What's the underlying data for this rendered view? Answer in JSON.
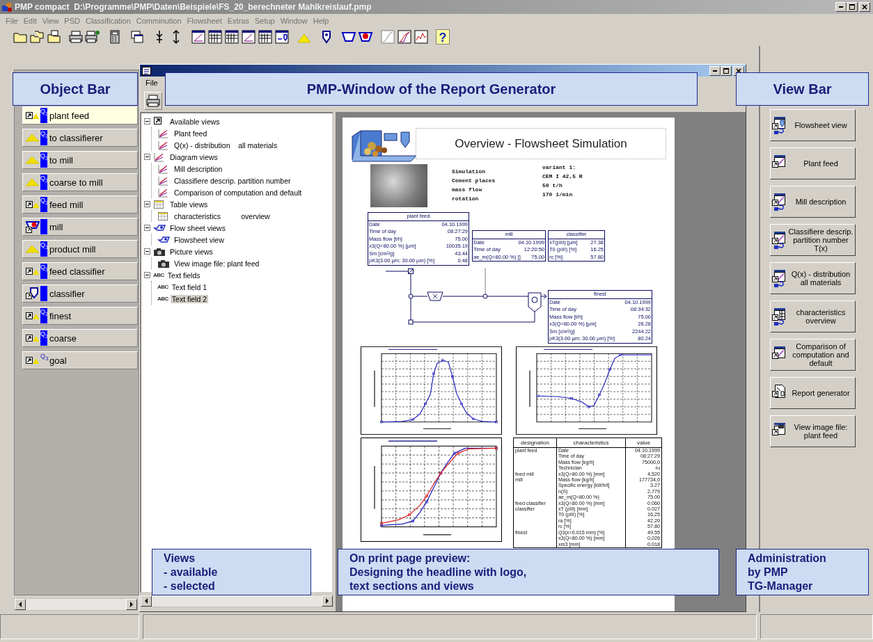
{
  "window": {
    "title": "PMP compact  D:\\Programme\\PMP\\Daten\\Beispiele\\FS_20_berechneter Mahlkreislauf.pmp"
  },
  "menu": [
    "File",
    "Edit",
    "View",
    "PSD",
    "Classification",
    "Comminution",
    "Flowsheet",
    "Extras",
    "Setup",
    "Window",
    "Help"
  ],
  "toolbar": {
    "help_glyph": "?"
  },
  "object_bar": {
    "items": [
      {
        "label": "plant feed",
        "kind": "shortcut",
        "badge": "Q$_{3}$",
        "selected": true
      },
      {
        "label": "to classifierer",
        "kind": "pile",
        "badge": "Q$_{3}$",
        "selected": false
      },
      {
        "label": "to mill",
        "kind": "pile",
        "badge": "Q$_{3}$",
        "selected": false
      },
      {
        "label": "coarse to mill",
        "kind": "pile",
        "badge": "Q$_{3}$",
        "selected": false
      },
      {
        "label": "feed mill",
        "kind": "shortcut",
        "badge": "Q$_{3}$",
        "selected": false
      },
      {
        "label": "mill",
        "kind": "mill",
        "selected": false
      },
      {
        "label": "product mill",
        "kind": "pile",
        "badge": "Q$_{3}$",
        "selected": false
      },
      {
        "label": "feed classifier",
        "kind": "shortcut",
        "badge": "Q$_{3}$",
        "selected": false
      },
      {
        "label": "classifier",
        "kind": "classifier",
        "selected": false
      },
      {
        "label": "finest",
        "kind": "shortcut",
        "badge": "Q$_{3}$",
        "selected": false
      },
      {
        "label": "coarse",
        "kind": "shortcut",
        "badge": "Q$_{3}$",
        "selected": false
      },
      {
        "label": "goal",
        "kind": "goal",
        "badge": "Q$_{3}$",
        "selected": false
      }
    ]
  },
  "report_window": {
    "menu": [
      "File"
    ],
    "tree": [
      {
        "label": "Available views",
        "kind": "shortcut",
        "expanded": true,
        "selected": false,
        "children": [
          {
            "label": "Plant feed",
            "kind": "chart",
            "selected": false
          },
          {
            "label": "Q(x) - distribution    all materials",
            "kind": "chart",
            "selected": false
          }
        ]
      },
      {
        "label": "Diagram views",
        "kind": "chart",
        "expanded": true,
        "selected": false,
        "children": [
          {
            "label": "Mill description",
            "kind": "chart",
            "selected": false
          },
          {
            "label": "Classifiere descrip. partition number",
            "kind": "chart",
            "selected": false
          },
          {
            "label": "Comparison of computation and default",
            "kind": "chart",
            "selected": false
          }
        ]
      },
      {
        "label": "Table views",
        "kind": "table",
        "expanded": true,
        "selected": false,
        "children": [
          {
            "label": "characteristics          overview",
            "kind": "table",
            "selected": false
          }
        ]
      },
      {
        "label": "Flow sheet views",
        "kind": "flowsheet",
        "expanded": true,
        "selected": false,
        "children": [
          {
            "label": "Flowsheet view",
            "kind": "flowsheet",
            "selected": false
          }
        ]
      },
      {
        "label": "Picture views",
        "kind": "camera",
        "expanded": true,
        "selected": false,
        "children": [
          {
            "label": "View image file: plant feed",
            "kind": "camera",
            "selected": false
          }
        ]
      },
      {
        "label": "Text fields",
        "kind": "text",
        "icon_glyph": "ABC",
        "expanded": true,
        "selected": false,
        "children": [
          {
            "label": "Text field 1",
            "kind": "text",
            "icon_glyph": "ABC",
            "selected": false
          },
          {
            "label": "Text field 2",
            "kind": "text",
            "icon_glyph": "ABC",
            "selected": true
          }
        ]
      }
    ],
    "preview": {
      "headline": "Overview - Flowsheet Simulation",
      "parameter_labels": [
        "Simulation",
        "Cement places",
        "mass flow",
        "rotation"
      ],
      "parameter_values": [
        "variant 1:",
        "CEM I 42,5 R",
        "50 t/h",
        "170 1/min"
      ],
      "info_tables": [
        {
          "title": "plant feed",
          "rows": [
            [
              "Date",
              "04.10.1999"
            ],
            [
              "Time of day",
              "08:27:29"
            ],
            [
              "Mass flow [t/h]",
              "75.00"
            ],
            [
              "x3(Q=80.00 %) [µm]",
              "10035.19"
            ],
            [
              "Sm [cm²/g]",
              "43.44"
            ],
            [
              "pK3(3.00 µm; 30.00 µm) [%]",
              "0.48"
            ]
          ]
        },
        {
          "title": "mill",
          "rows": [
            [
              "Date",
              "04.10.1999"
            ],
            [
              "Time of day",
              "12:20:50"
            ],
            [
              "ae_m(Q=80.00 %) []",
              "75.00"
            ]
          ]
        },
        {
          "title": "classifier",
          "rows": [
            [
              "xT(pIII) [µm]",
              "27.38"
            ],
            [
              "T0 (pIII) [%]",
              "16.25"
            ],
            [
              "rc [%]",
              "57.80"
            ]
          ]
        },
        {
          "title": "finest",
          "rows": [
            [
              "Date",
              "04.10.1999"
            ],
            [
              "Time of day",
              "08:34:32"
            ],
            [
              "Mass flow [t/h]",
              "75.00"
            ],
            [
              "x3(Q=80.00 %) [µm]",
              "26.28"
            ],
            [
              "Sm [cm²/g]",
              "2244.22"
            ],
            [
              "pK3(3.00 µm; 30.00 µm) [%]",
              "80.24"
            ]
          ]
        }
      ],
      "charts": [
        {
          "kind": "density"
        },
        {
          "kind": "partition"
        },
        {
          "kind": "distribution"
        }
      ],
      "characteristics_table": {
        "columns": [
          "designation",
          "characteristics",
          "value"
        ],
        "rows": [
          [
            "plant feed",
            "Date",
            "04.10.1999"
          ],
          [
            "",
            "Time of day",
            "08:27:29"
          ],
          [
            "",
            "Mass flow [kg/h]",
            "75000,0"
          ],
          [
            "",
            "Technician",
            "ru"
          ],
          [
            "feed mill",
            "x3(Q=80.00 %) [mm]",
            "4,520"
          ],
          [
            "mill",
            "Mass flow [kg/h]",
            "177734,0"
          ],
          [
            "",
            "Specific energy [kWh/t]",
            "3.27"
          ],
          [
            "",
            "n(S)",
            "2,779"
          ],
          [
            "",
            "ae_m(Q=80.00 %)",
            "75.00"
          ],
          [
            "feed classifier",
            "x3(Q=80.00 %) [mm]",
            "0.060"
          ],
          [
            "classifier",
            "xT (pIII) [mm]",
            "0.027"
          ],
          [
            "",
            "T0 (pIII) [%]",
            "16,25"
          ],
          [
            "",
            "ra [%]",
            "42.20"
          ],
          [
            "",
            "rc [%]",
            "57.80"
          ],
          [
            "finest",
            "Q3(x=0.015 mm) [%]",
            "49.55"
          ],
          [
            "",
            "x3(Q=80.00 %) [mm]",
            "0,026"
          ],
          [
            "",
            "xm3 [mm]",
            "0.018"
          ]
        ]
      }
    }
  },
  "view_bar": {
    "buttons": [
      {
        "label": "Flowsheet view",
        "kind": "flowsheet",
        "linked": true
      },
      {
        "label": "Plant feed",
        "kind": "chart",
        "linked": false
      },
      {
        "label": "Mill description",
        "kind": "chart",
        "linked": true
      },
      {
        "label": "Classifiere descrip. partition number T(x)",
        "kind": "chart",
        "linked": true
      },
      {
        "label": "Q(x) - distribution all materials",
        "kind": "chart",
        "linked": true
      },
      {
        "label": "characteristics overview",
        "kind": "table",
        "linked": true
      },
      {
        "label": "Comparison of computation and default",
        "kind": "chart",
        "linked": false
      },
      {
        "label": "Report generator",
        "kind": "report",
        "linked": false
      },
      {
        "label": "View image file: plant feed",
        "kind": "image",
        "linked": false
      }
    ]
  },
  "callouts": {
    "object_bar": [
      "Object Bar"
    ],
    "report_window": [
      "PMP-Window of the Report Generator"
    ],
    "view_bar": [
      "View Bar"
    ],
    "views": [
      "Views",
      "- available",
      "- selected"
    ],
    "preview": [
      "On print page preview:",
      "Designing the headline with logo,",
      "text sections and views"
    ],
    "administration": [
      "Administration",
      "by PMP",
      "TG-Manager"
    ]
  }
}
